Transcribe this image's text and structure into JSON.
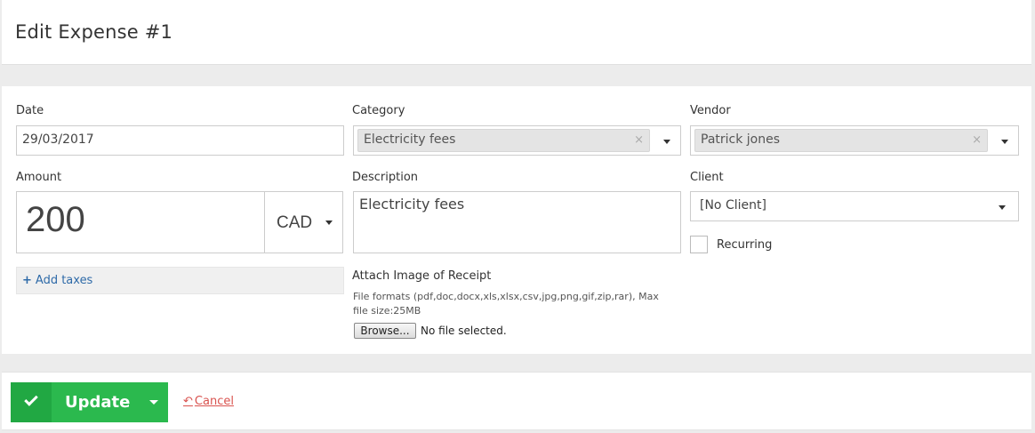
{
  "header": {
    "title": "Edit Expense #1"
  },
  "form": {
    "date": {
      "label": "Date",
      "value": "29/03/2017"
    },
    "category": {
      "label": "Category",
      "value": "Electricity fees",
      "clear": "×"
    },
    "vendor": {
      "label": "Vendor",
      "value": "Patrick jones",
      "clear": "×"
    },
    "amount": {
      "label": "Amount",
      "value": "200",
      "currency": "CAD"
    },
    "description": {
      "label": "Description",
      "value": "Electricity fees"
    },
    "client": {
      "label": "Client",
      "value": "[No Client]"
    },
    "recurring": {
      "label": "Recurring",
      "checked": false
    },
    "add_taxes": {
      "label": "Add taxes"
    },
    "attachment": {
      "label": "Attach Image of Receipt",
      "note": "File formats (pdf,doc,docx,xls,xlsx,csv,jpg,png,gif,zip,rar), Max file size:25MB",
      "browse_label": "Browse...",
      "status": "No file selected."
    }
  },
  "footer": {
    "update_label": "Update",
    "cancel_label": "Cancel"
  },
  "colors": {
    "update_green": "#2bb94e",
    "update_check_green": "#21a843",
    "link_blue": "#2e6aa8",
    "cancel_red": "#d9534f"
  },
  "icons": {
    "update": "check-icon",
    "update_menu": "caret-down-icon",
    "cancel": "undo-icon",
    "add_taxes": "plus-icon"
  }
}
